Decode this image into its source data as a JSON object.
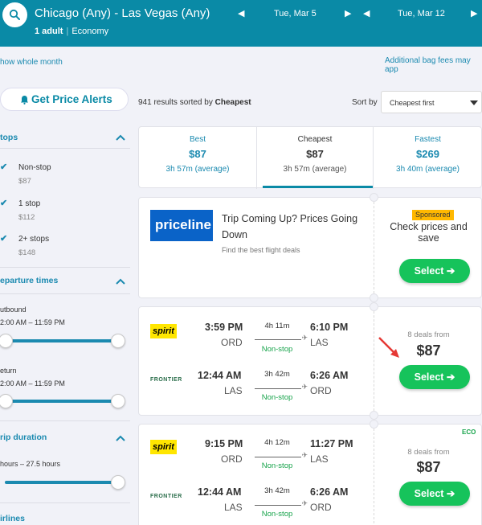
{
  "header": {
    "route": "Chicago (Any) - Las Vegas (Any)",
    "passengers": "1 adult",
    "cabin": "Economy",
    "depart_date": "Tue, Mar 5",
    "return_date": "Tue, Mar 12",
    "bg_color": "#0a8aa6"
  },
  "links": {
    "whole_month": "how whole month",
    "bag_fees": "Additional bag fees may app"
  },
  "alerts": {
    "label": "Get Price Alerts"
  },
  "results": {
    "count_text": "941 results sorted by ",
    "sort_bold": "Cheapest",
    "sort_label": "Sort by",
    "sort_value": "Cheapest first"
  },
  "sidebar": {
    "stops_title": "tops",
    "stops": [
      {
        "label": "Non-stop",
        "price": "$87"
      },
      {
        "label": "1 stop",
        "price": "$112"
      },
      {
        "label": "2+ stops",
        "price": "$148"
      }
    ],
    "departure_title": "eparture times",
    "outbound_label": "utbound",
    "outbound_range": "2:00 AM – 11:59 PM",
    "return_label": "eturn",
    "return_range": "2:00 AM – 11:59 PM",
    "trip_title": "rip duration",
    "trip_range": "hours – 27.5 hours",
    "airlines_title": "irlines"
  },
  "tabs": [
    {
      "name": "Best",
      "price": "$87",
      "time": "3h 57m (average)"
    },
    {
      "name": "Cheapest",
      "price": "$87",
      "time": "3h 57m (average)"
    },
    {
      "name": "Fastest",
      "price": "$269",
      "time": "3h 40m (average)"
    }
  ],
  "ad": {
    "logo": "priceline",
    "title": "Trip Coming Up? Prices Going Down",
    "desc": "Find the best flight deals",
    "sponsored": "Sponsored",
    "side_text": "Check prices and save",
    "select": "Select ➔"
  },
  "results_list": [
    {
      "deals": "8 deals from",
      "price": "$87",
      "select": "Select ➔",
      "legs": [
        {
          "airline": "spirit",
          "dep_time": "3:59 PM",
          "dep": "ORD",
          "duration": "4h 11m",
          "stops": "Non-stop",
          "arr_time": "6:10 PM",
          "arr": "LAS"
        },
        {
          "airline": "FRONTIER",
          "dep_time": "12:44 AM",
          "dep": "LAS",
          "duration": "3h 42m",
          "stops": "Non-stop",
          "arr_time": "6:26 AM",
          "arr": "ORD"
        }
      ]
    },
    {
      "eco": "ECO",
      "deals": "8 deals from",
      "price": "$87",
      "select": "Select ➔",
      "legs": [
        {
          "airline": "spirit",
          "dep_time": "9:15 PM",
          "dep": "ORD",
          "duration": "4h 12m",
          "stops": "Non-stop",
          "arr_time": "11:27 PM",
          "arr": "LAS"
        },
        {
          "airline": "FRONTIER",
          "dep_time": "12:44 AM",
          "dep": "LAS",
          "duration": "3h 42m",
          "stops": "Non-stop",
          "arr_time": "6:26 AM",
          "arr": "ORD"
        }
      ]
    }
  ]
}
